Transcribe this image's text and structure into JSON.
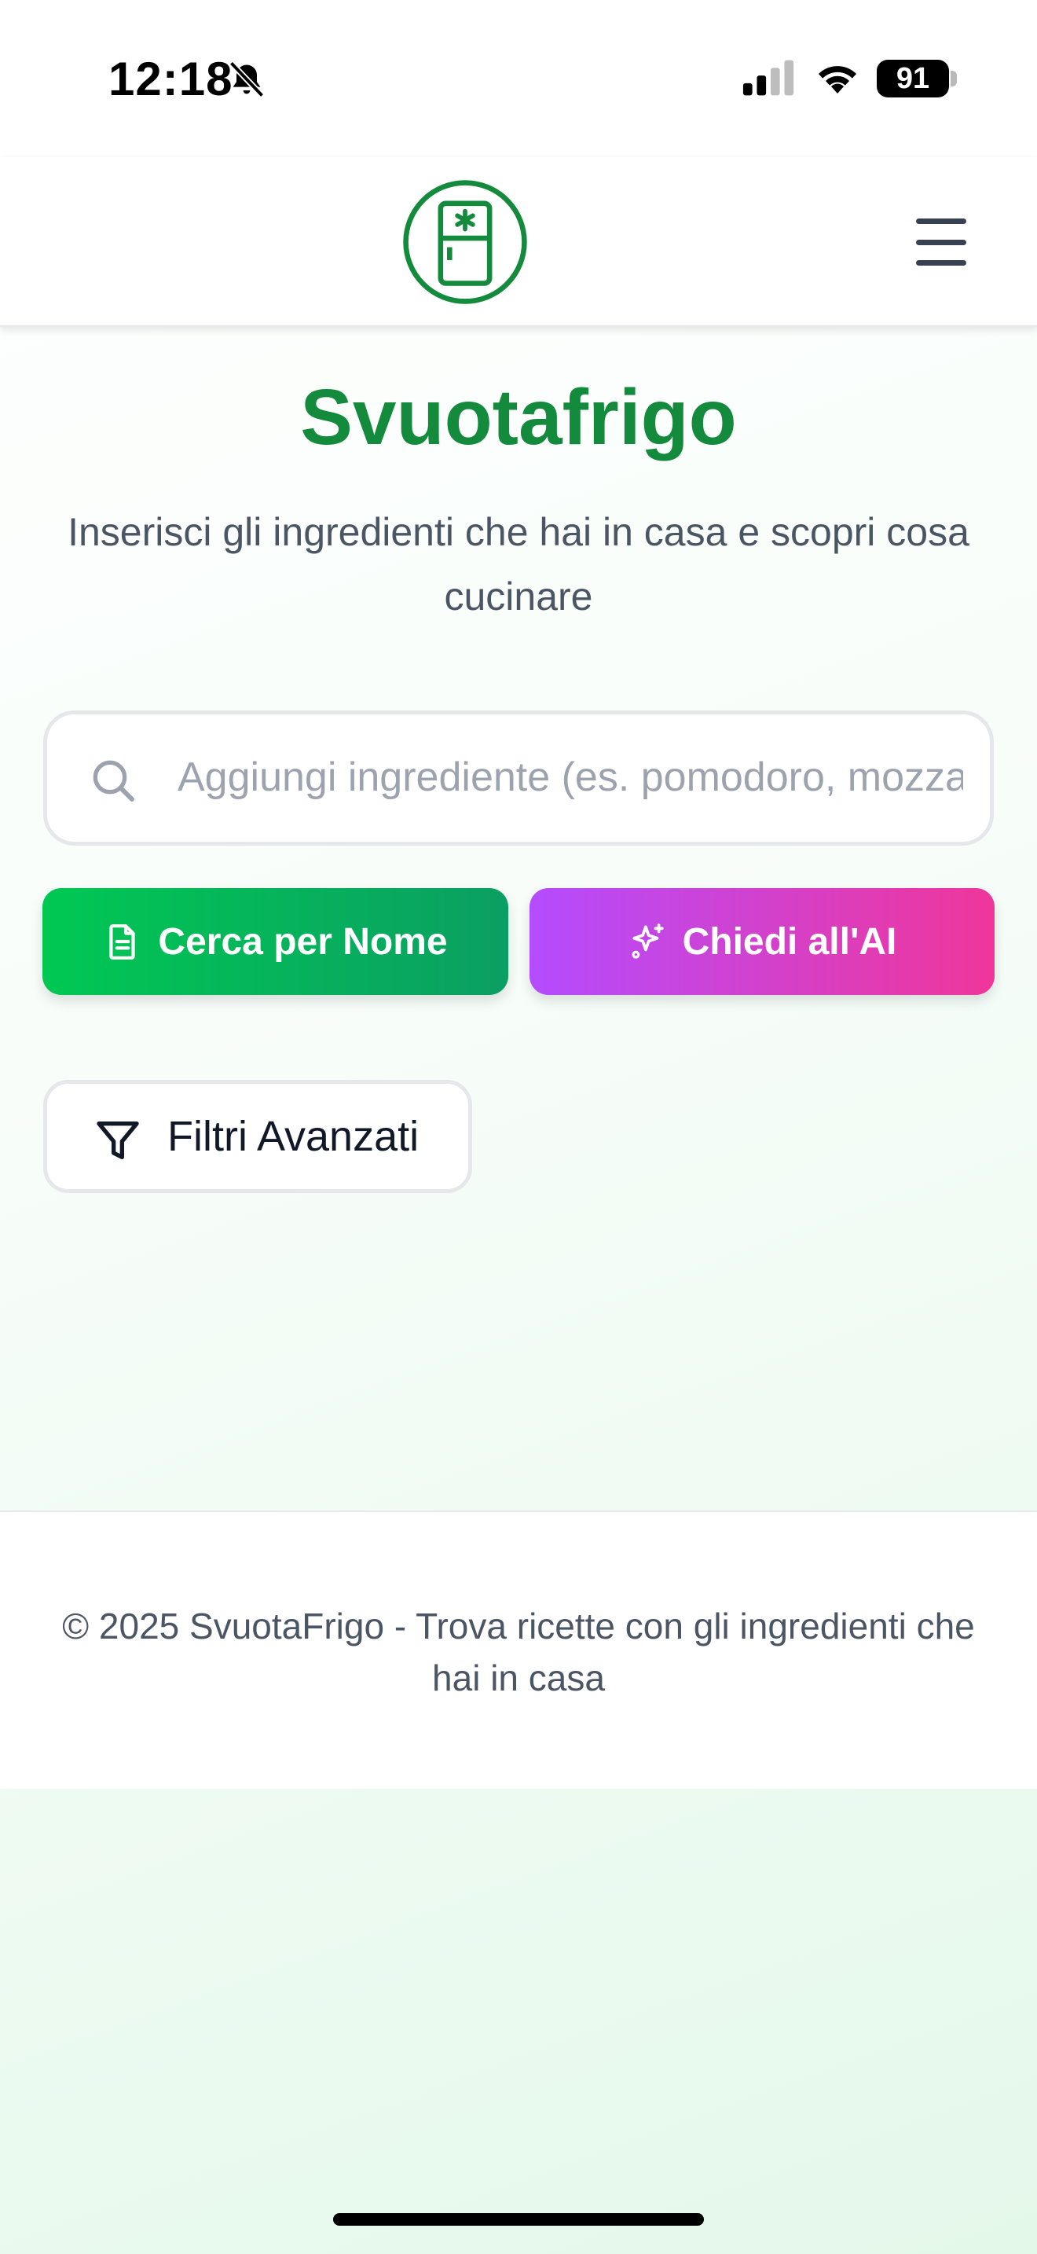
{
  "status_bar": {
    "time": "12:18",
    "battery_level": "91",
    "icons": [
      "bell-slash-icon",
      "signal-icon",
      "wifi-icon",
      "battery-icon"
    ]
  },
  "header": {
    "logo_icon": "fridge-icon",
    "menu_icon": "hamburger-menu-icon",
    "brand_color": "#138a3c"
  },
  "main": {
    "title": "Svuotafrigo",
    "subtitle": "Inserisci gli ingredienti che hai in casa e scopri cosa cucinare",
    "search": {
      "placeholder": "Aggiungi ingrediente (es. pomodoro, mozzarella)",
      "value": ""
    },
    "buttons": {
      "search_by_name": "Cerca per Nome",
      "ask_ai": "Chiedi all'AI"
    },
    "filters_label": "Filtri Avanzati"
  },
  "footer": {
    "text": "© 2025 SvuotaFrigo - Trova ricette con gli ingredienti che hai in casa"
  },
  "colors": {
    "green_start": "#00c853",
    "green_end": "#0b9f63",
    "ai_start": "#b44cff",
    "ai_end": "#f0369a"
  }
}
